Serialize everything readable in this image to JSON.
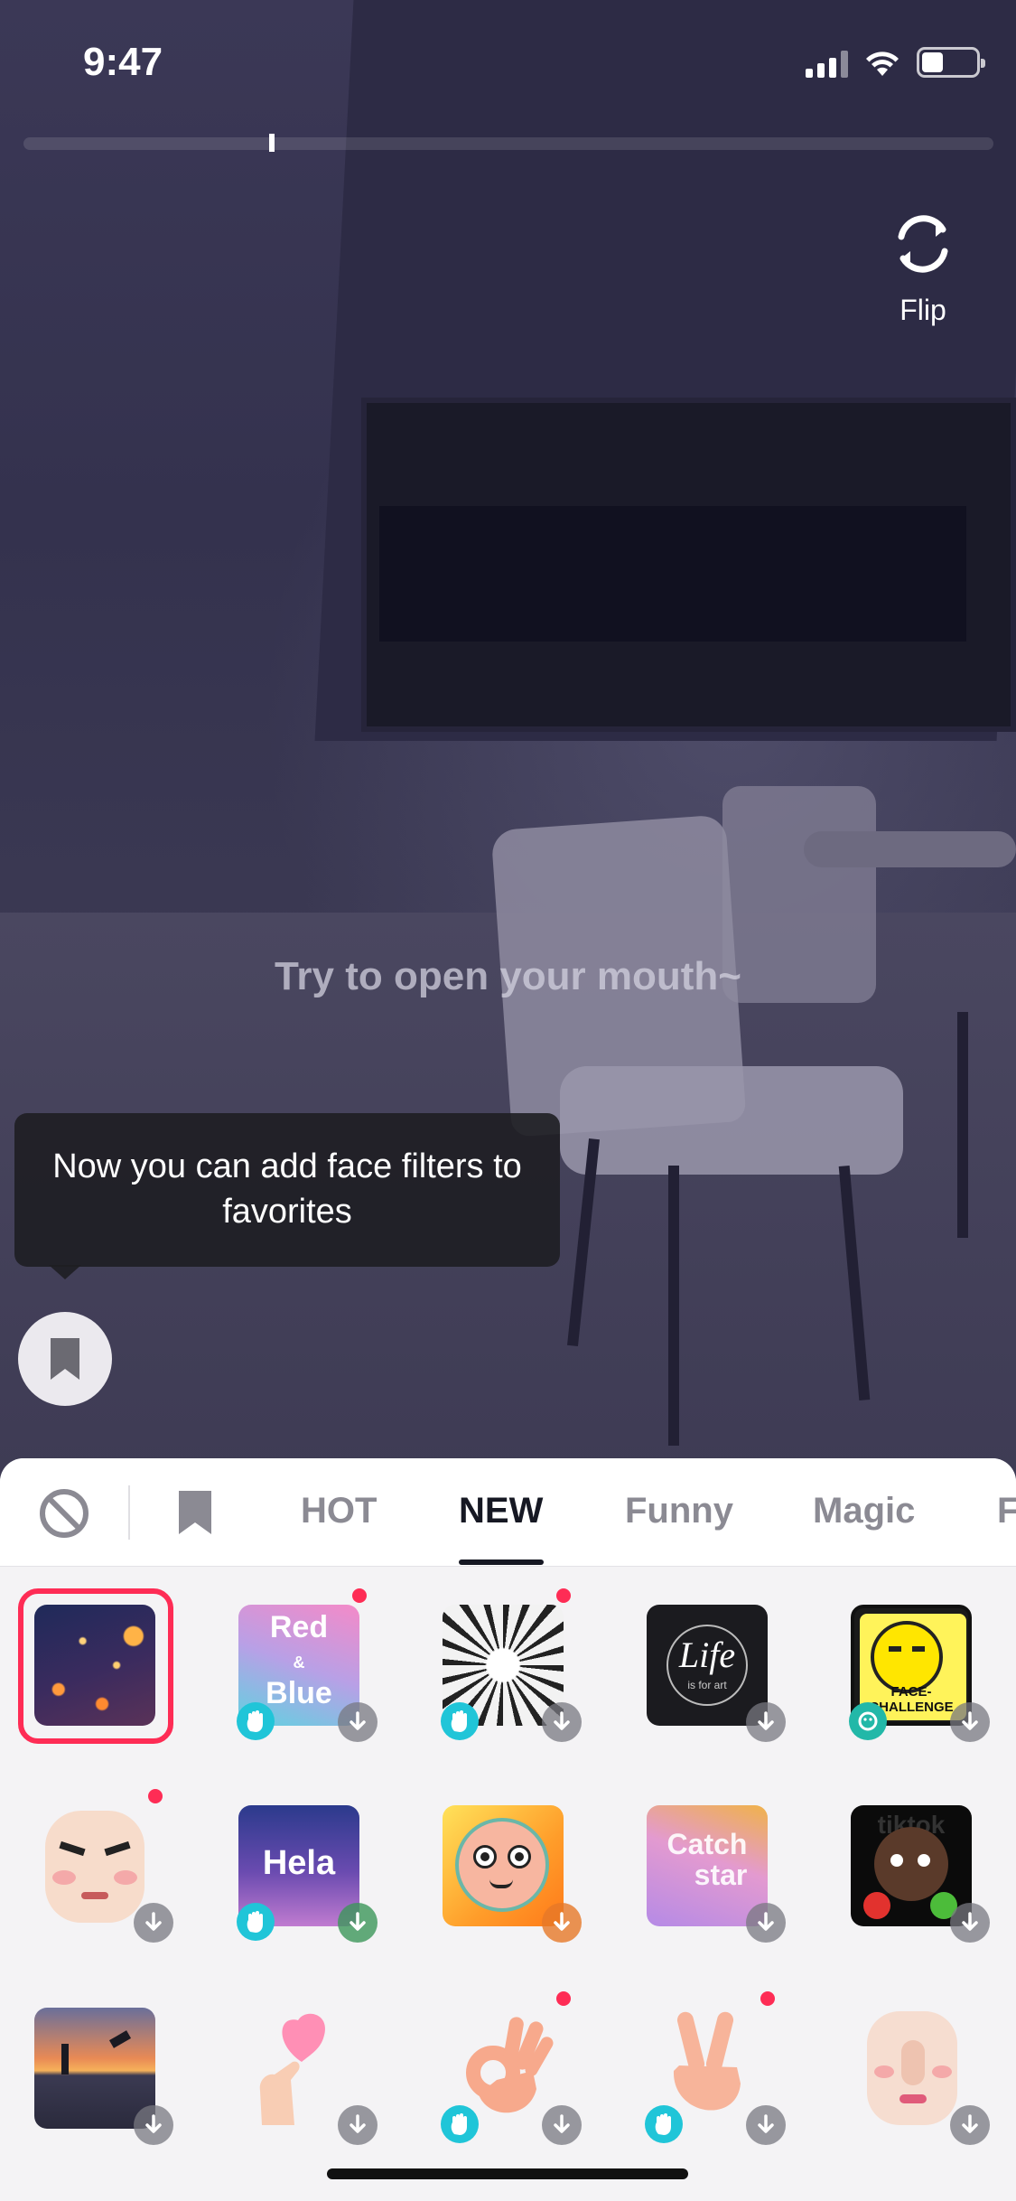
{
  "status_bar": {
    "time": "9:47"
  },
  "camera": {
    "flip_label": "Flip",
    "hint": "Try to open your mouth~"
  },
  "tooltip": {
    "text": "Now you can add face filters to favorites"
  },
  "tabs": [
    {
      "label": "HOT"
    },
    {
      "label": "NEW",
      "active": true
    },
    {
      "label": "Funny"
    },
    {
      "label": "Magic"
    },
    {
      "label": "F"
    }
  ],
  "effects": [
    {
      "row": 0,
      "label": ""
    },
    {
      "row": 0,
      "label_line1": "Red",
      "label_amp": "&",
      "label_line2": "Blue"
    },
    {
      "row": 0,
      "label": ""
    },
    {
      "row": 0,
      "label_script": "Life",
      "label_sub": "is for art"
    },
    {
      "row": 0,
      "label_line1": "FACE-",
      "label_line2": "CHALLENGE"
    },
    {
      "row": 1,
      "label": ""
    },
    {
      "row": 1,
      "label": "Hela"
    },
    {
      "row": 1,
      "label": ""
    },
    {
      "row": 1,
      "label_line1": "Catch",
      "label_line2": "star"
    },
    {
      "row": 1,
      "label": "tiktok"
    }
  ],
  "colors": {
    "accent": "#fe2c55",
    "hand_badge": "#20c5d8"
  }
}
